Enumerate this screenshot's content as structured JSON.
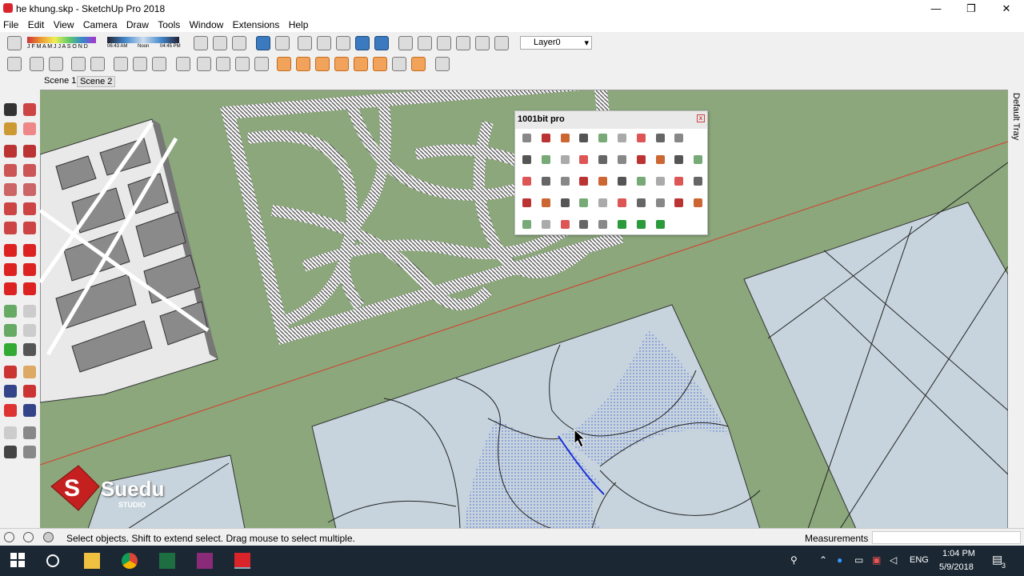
{
  "window": {
    "title": "he khung.skp - SketchUp Pro 2018",
    "minimize_glyph": "—",
    "restore_glyph": "❐",
    "close_glyph": "✕"
  },
  "menu": [
    "File",
    "Edit",
    "View",
    "Camera",
    "Draw",
    "Tools",
    "Window",
    "Extensions",
    "Help"
  ],
  "shadow_settings": {
    "months": "J F M A M J J A S O N D",
    "time_start": "06:43 AM",
    "time_mid": "Noon",
    "time_end": "04:45 PM"
  },
  "layer": {
    "current": "Layer0",
    "dropdown_glyph": "▾"
  },
  "scenes": [
    {
      "label": "Scene 1",
      "active": false
    },
    {
      "label": "Scene 2",
      "active": true
    }
  ],
  "tray": {
    "label": "Default Tray"
  },
  "plugin_panel": {
    "title": "1001bit pro",
    "close_glyph": "x",
    "icon_rows": [
      9,
      10,
      10,
      10,
      8
    ]
  },
  "statusbar": {
    "hint": "Select objects. Shift to extend select. Drag mouse to select multiple.",
    "measurements_label": "Measurements",
    "measurements_value": ""
  },
  "taskbar": {
    "time": "1:04 PM",
    "date": "5/9/2018",
    "language": "ENG",
    "notifications_count": "3",
    "apps": [
      "windows-start",
      "cortana",
      "file-explorer",
      "chrome",
      "excel",
      "media-app",
      "sketchup"
    ]
  },
  "logo": {
    "text": "Suedu",
    "sub": "STUDIO"
  },
  "colors": {
    "ground": "#8ba77b",
    "face": "#c7d4dd",
    "selected_edge": "#1a2fd8",
    "red_axis": "#d93a2a",
    "sketchup_red": "#d9242b"
  }
}
